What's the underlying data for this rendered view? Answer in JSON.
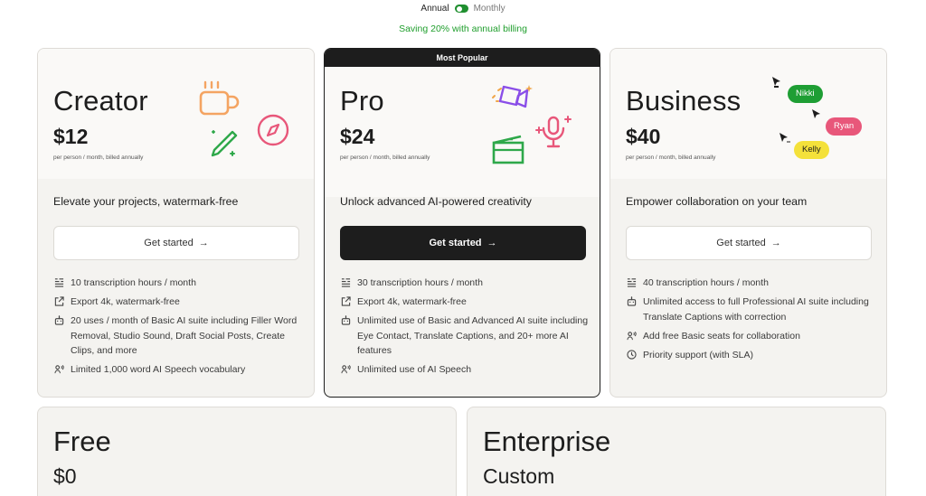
{
  "billing": {
    "annual": "Annual",
    "monthly": "Monthly",
    "saving": "Saving 20% with annual billing"
  },
  "plans": [
    {
      "name": "Creator",
      "price": "$12",
      "note": "per person / month, billed annually",
      "tagline": "Elevate your projects, watermark-free",
      "cta": "Get started",
      "features": [
        "10 transcription hours / month",
        "Export 4k, watermark-free",
        "20 uses / month of Basic AI suite including Filler Word Removal, Studio Sound, Draft Social Posts, Create Clips, and more",
        "Limited 1,000 word AI Speech vocabulary"
      ]
    },
    {
      "badge": "Most Popular",
      "name": "Pro",
      "price": "$24",
      "note": "per person / month, billed annually",
      "tagline": "Unlock advanced AI-powered creativity",
      "cta": "Get started",
      "features": [
        "30 transcription hours / month",
        "Export 4k, watermark-free",
        "Unlimited use of Basic and Advanced AI suite including Eye Contact, Translate Captions, and 20+ more AI features",
        "Unlimited use of AI Speech"
      ]
    },
    {
      "name": "Business",
      "price": "$40",
      "note": "per person / month, billed annually",
      "tagline": "Empower collaboration on your team",
      "cta": "Get started",
      "features": [
        "40 transcription hours / month",
        "Unlimited access to full Professional AI suite including Translate Captions with correction",
        "Add free Basic seats for collaboration",
        "Priority support (with SLA)"
      ],
      "collaborators": [
        "Nikki",
        "Ryan",
        "Kelly"
      ]
    }
  ],
  "bottom": [
    {
      "name": "Free",
      "price": "$0"
    },
    {
      "name": "Enterprise",
      "price": "Custom"
    }
  ],
  "colors": {
    "toggle": "#1f8f2f",
    "saving": "#1f9e2c",
    "dark": "#1d1d1d"
  }
}
